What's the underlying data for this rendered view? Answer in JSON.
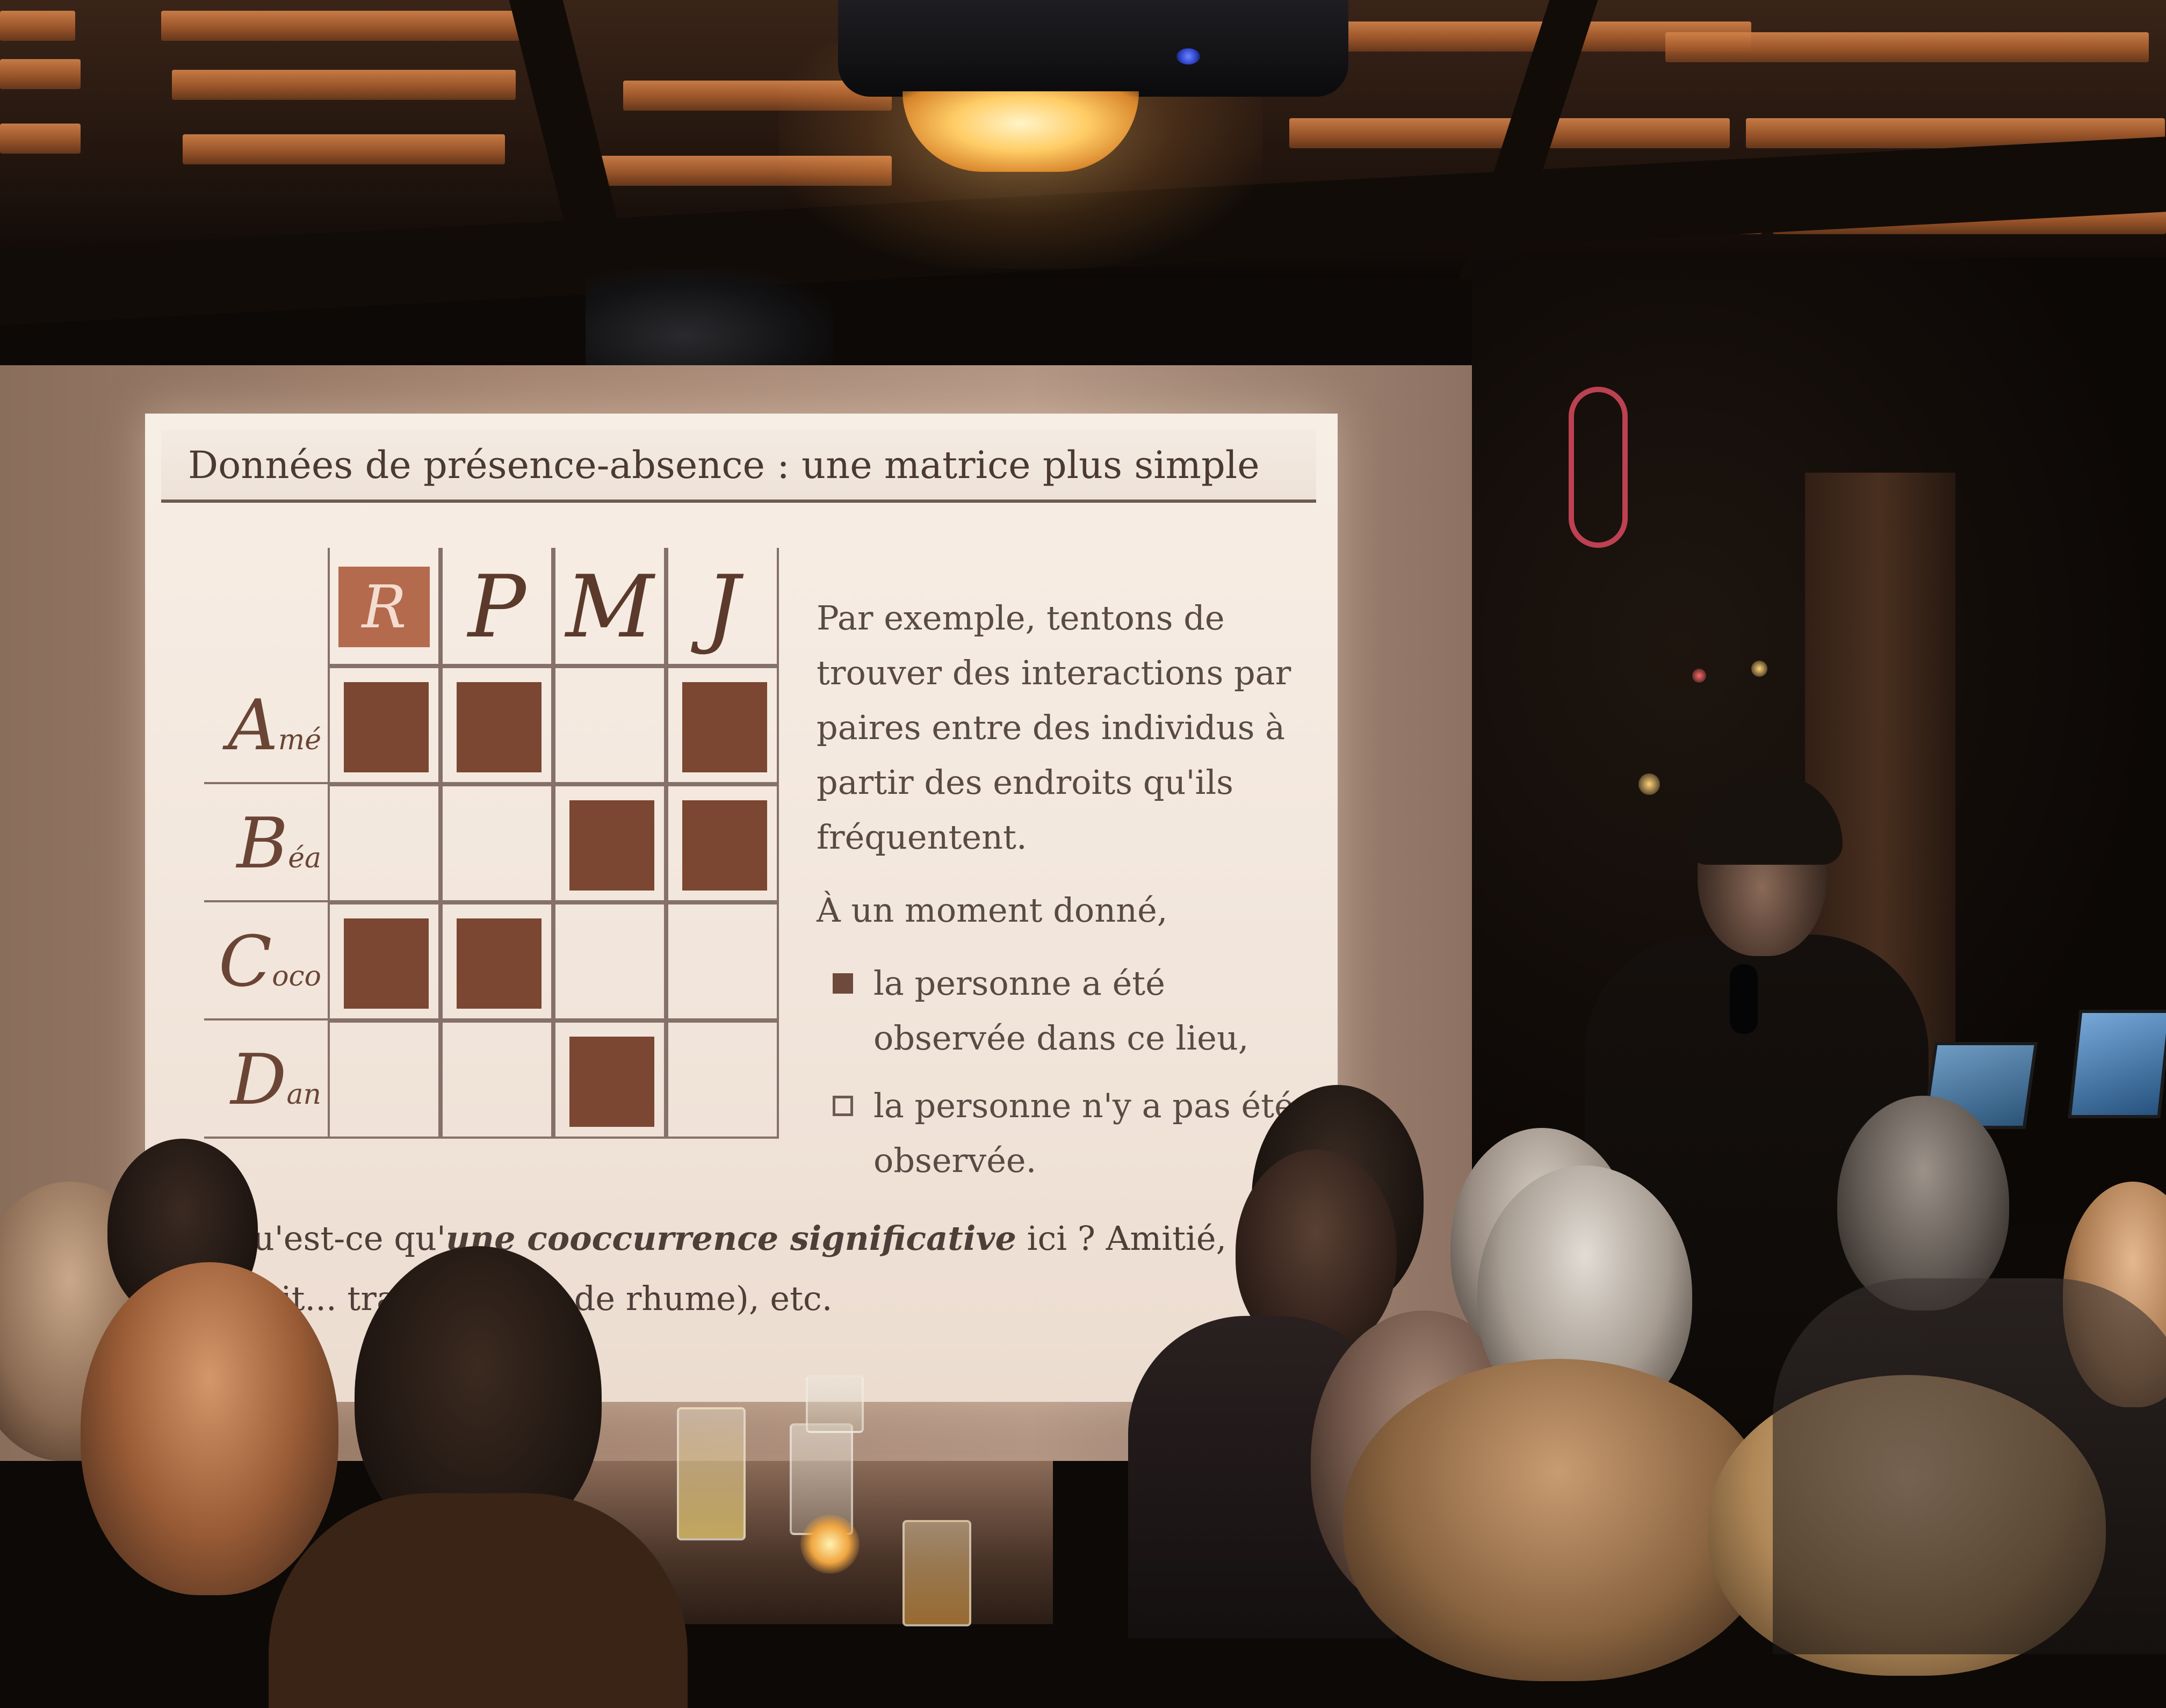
{
  "slide": {
    "title": "Données de présence-absence : une matrice plus simple",
    "columns": [
      {
        "label": "R",
        "style": "badge"
      },
      {
        "label": "P",
        "style": "glyph"
      },
      {
        "label": "M",
        "style": "glyph"
      },
      {
        "label": "J",
        "style": "glyph"
      }
    ],
    "rows": [
      {
        "initial": "A",
        "rest": "mé",
        "marks": [
          1,
          1,
          0,
          1
        ]
      },
      {
        "initial": "B",
        "rest": "éa",
        "marks": [
          0,
          0,
          1,
          1
        ]
      },
      {
        "initial": "C",
        "rest": "oco",
        "marks": [
          1,
          1,
          0,
          0
        ]
      },
      {
        "initial": "D",
        "rest": "an",
        "marks": [
          0,
          0,
          1,
          0
        ]
      }
    ],
    "intro": "Par exemple, tentons de trouver des interactions par paires entre des individus à partir des endroits qu'ils fréquentent.",
    "moment": "À un moment donné,",
    "legend_present": "la personne a été observée dans ce lieu,",
    "legend_absent": "la personne n'y a pas été observée.",
    "question_prefix": "Qu'est-ce qu'",
    "question_emph": "une cooccurrence significative",
    "question_suffix": " ici ? Amitié,",
    "question_line2": "(imit... transmission de rhume), etc."
  },
  "colors": {
    "mark": "#7b4632",
    "badge": "#b46a4d",
    "slide_bg": "#f4ebe2",
    "rope": "#d94a5e",
    "lamp": "#ffcd66"
  }
}
